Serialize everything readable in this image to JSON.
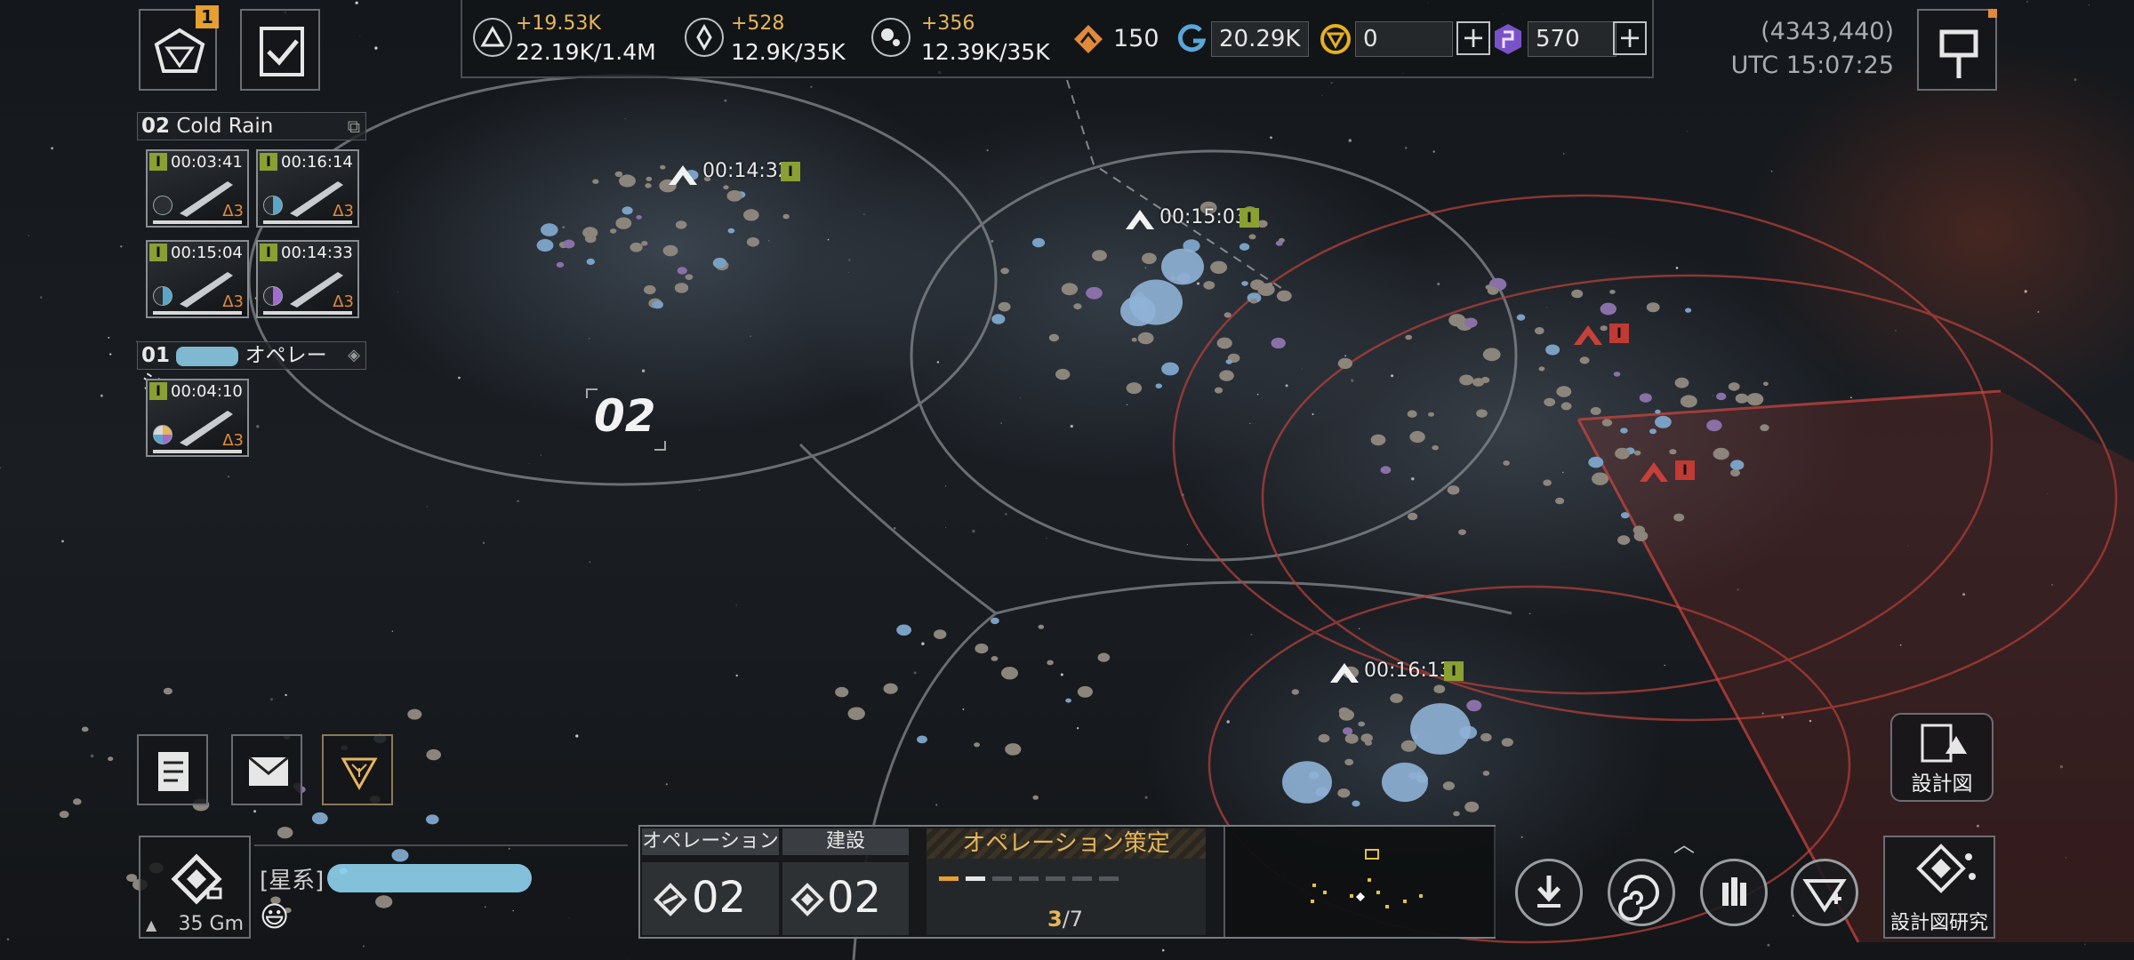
{
  "resources": [
    {
      "icon": "alloy-icon",
      "delta": "+19.53K",
      "value": "22.19K/1.4M"
    },
    {
      "icon": "crystal-icon",
      "delta": "+528",
      "value": "12.9K/35K"
    },
    {
      "icon": "gas-icon",
      "delta": "+356",
      "value": "12.39K/35K"
    }
  ],
  "currencies": {
    "rank_points": "150",
    "credits": "20.29K",
    "gold": "0",
    "premium": "570"
  },
  "coords": {
    "position": "(4343,440)",
    "time": "UTC 15:07:25"
  },
  "left_top": {
    "notification_count": "1"
  },
  "fleets": [
    {
      "number": "02",
      "name": "Cold Rain",
      "ships": [
        {
          "time": "00:03:41",
          "tier": "Δ3",
          "badge": "I"
        },
        {
          "time": "00:16:14",
          "tier": "Δ3",
          "badge": "I"
        },
        {
          "time": "00:15:04",
          "tier": "Δ3",
          "badge": "I"
        },
        {
          "time": "00:14:33",
          "tier": "Δ3",
          "badge": "I"
        }
      ]
    },
    {
      "number": "01",
      "name": "オペレーシ...",
      "ships": [
        {
          "time": "00:04:10",
          "tier": "Δ3",
          "badge": "I"
        }
      ]
    }
  ],
  "map": {
    "zone_label": "02",
    "markers": [
      {
        "time": "00:14:32",
        "badge": "I",
        "hostile": false
      },
      {
        "time": "00:15:03",
        "badge": "I",
        "hostile": false
      },
      {
        "time": "00:16:13",
        "badge": "I",
        "hostile": false
      },
      {
        "time": "",
        "badge": "I",
        "hostile": true
      },
      {
        "time": "",
        "badge": "I",
        "hostile": true
      }
    ]
  },
  "player": {
    "system_label": "[星系]",
    "distance": "35 Gm",
    "emoji": "😃"
  },
  "operation": {
    "tab1": "オペレーション",
    "tab2": "建設",
    "tab3": "オペレーション策定",
    "count1": "02",
    "count2": "02",
    "progress_current": "3",
    "progress_total": "/7"
  },
  "buttons": {
    "blueprint": "設計図",
    "blueprint_research": "設計図研究"
  },
  "colors": {
    "accent": "#e6b65a",
    "hostile": "#c03a34",
    "friendly_badge": "#8aa032",
    "orange": "#e08a3a"
  }
}
